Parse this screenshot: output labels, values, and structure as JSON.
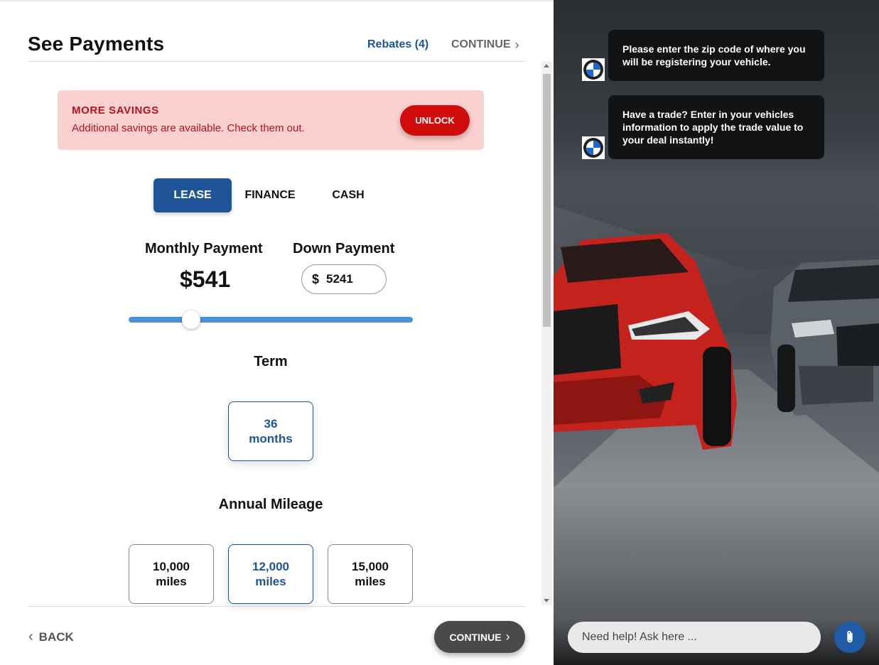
{
  "header": {
    "title": "See Payments",
    "rebates_label": "Rebates (4)",
    "continue_label": "CONTINUE"
  },
  "savings": {
    "title": "MORE SAVINGS",
    "text": "Additional savings are available. Check them out.",
    "unlock_label": "UNLOCK"
  },
  "tabs": [
    {
      "label": "LEASE",
      "selected": true
    },
    {
      "label": "FINANCE",
      "selected": false
    },
    {
      "label": "CASH",
      "selected": false
    }
  ],
  "payment": {
    "monthly_label": "Monthly Payment",
    "monthly_value": "$541",
    "down_label": "Down Payment",
    "down_currency": "$",
    "down_value": "5241",
    "slider_fraction": 0.22
  },
  "term": {
    "label": "Term",
    "options": [
      {
        "line1": "36",
        "line2": "months",
        "selected": true
      }
    ]
  },
  "mileage": {
    "label": "Annual Mileage",
    "options": [
      {
        "line1": "10,000",
        "line2": "miles",
        "selected": false
      },
      {
        "line1": "12,000",
        "line2": "miles",
        "selected": true
      },
      {
        "line1": "15,000",
        "line2": "miles",
        "selected": false
      }
    ]
  },
  "footer": {
    "back_label": "BACK",
    "continue_label": "CONTINUE"
  },
  "chat": {
    "messages": [
      {
        "text": "Please enter the zip code of where you will be registering your vehicle."
      },
      {
        "text": "Have a trade? Enter in your vehicles information to apply the trade value to your deal instantly!"
      }
    ],
    "input_placeholder": "Need help! Ask here ..."
  },
  "icons": {
    "header_continue": "chevron-right-icon",
    "back": "chevron-left-icon",
    "footer_continue": "chevron-right-icon",
    "avatar": "bmw-logo-icon",
    "attach": "paperclip-icon"
  },
  "colors": {
    "brand_blue": "#1f5598",
    "savings_red": "#d10c0c",
    "savings_bg": "#fbd0d0",
    "slider": "#4a90d9"
  }
}
